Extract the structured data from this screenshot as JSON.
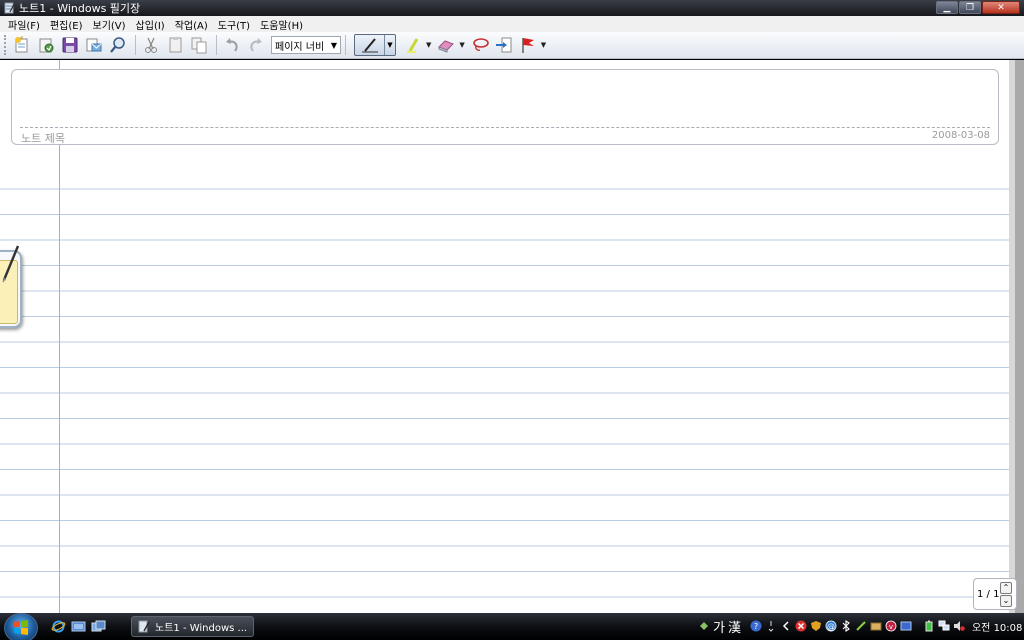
{
  "window": {
    "title": "노트1 - Windows 필기장",
    "controls": [
      "minimize",
      "maximize",
      "close"
    ]
  },
  "menu": [
    {
      "label": "파일(F)"
    },
    {
      "label": "편집(E)"
    },
    {
      "label": "보기(V)"
    },
    {
      "label": "삽입(I)"
    },
    {
      "label": "작업(A)"
    },
    {
      "label": "도구(T)"
    },
    {
      "label": "도움말(H)"
    }
  ],
  "toolbar": {
    "zoom_value": "페이지 너비",
    "buttons": [
      "new-note-icon",
      "open-icon",
      "save-icon",
      "send-mail-icon",
      "find-icon",
      "cut-icon",
      "copy-icon",
      "paste-icon",
      "undo-icon",
      "redo-icon",
      "pen-icon",
      "highlighter-icon",
      "eraser-icon",
      "lasso-icon",
      "insert-space-icon",
      "flag-icon"
    ]
  },
  "note": {
    "title_placeholder": "노트 제목",
    "date": "2008-03-08"
  },
  "page_nav": {
    "count": "1 / 1"
  },
  "taskbar": {
    "task_label": "노트1 - Windows ...",
    "ime_hangul": "가",
    "ime_hanja": "漢",
    "clock": "오전 10:08"
  },
  "colors": {
    "ruled_line": "#b8cbe0",
    "margin_line": "#c9a0b0",
    "titlebar": "#15171c"
  }
}
